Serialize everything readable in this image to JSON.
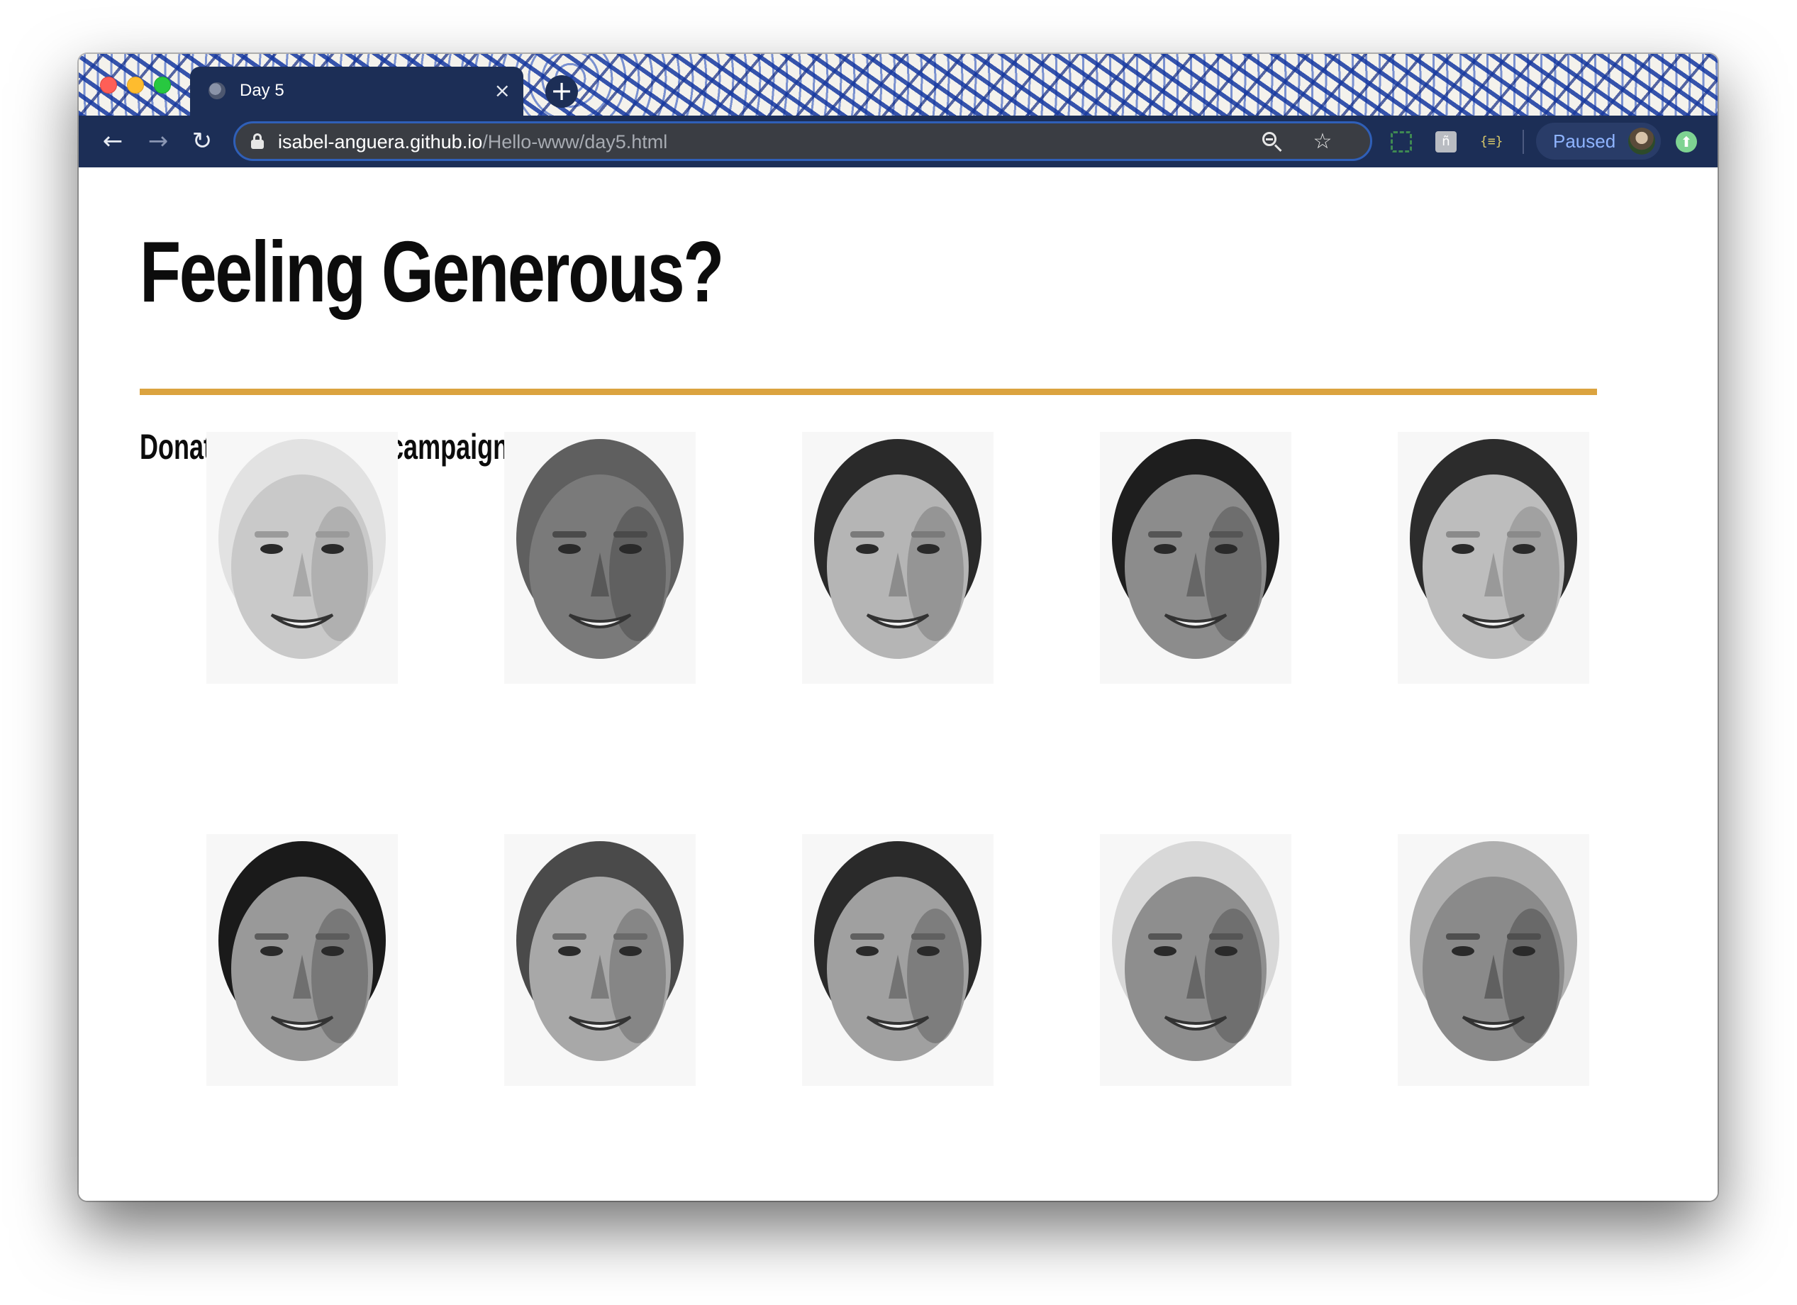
{
  "browser": {
    "tab": {
      "title": "Day 5",
      "close_glyph": "×"
    },
    "new_tab_glyph": "+",
    "nav": {
      "back_glyph": "←",
      "forward_glyph": "→",
      "reload_glyph": "↻"
    },
    "address": {
      "host": "isabel-anguera.github.io",
      "path": "/Hello-www/day5.html"
    },
    "bookmark_glyph": "☆",
    "extensions": {
      "square_glyph": "ñ",
      "brackets_glyph": "{≡}"
    },
    "profile": {
      "label": "Paused"
    },
    "update_glyph": "⬆"
  },
  "page": {
    "title": "Feeling Generous?",
    "subtitle": "Donate to a political campaign:",
    "accent_color": "#dba33f"
  },
  "candidates": [
    {
      "icon": "face-portrait-icon",
      "skin": "#c9c9c9",
      "hair": "#e2e2e2",
      "shadow": "#9a9a9a"
    },
    {
      "icon": "face-portrait-icon",
      "skin": "#7a7a7a",
      "hair": "#5f5f5f",
      "shadow": "#4a4a4a"
    },
    {
      "icon": "face-portrait-icon",
      "skin": "#b5b5b5",
      "hair": "#2a2a2a",
      "shadow": "#7a7a7a"
    },
    {
      "icon": "face-portrait-icon",
      "skin": "#8c8c8c",
      "hair": "#1e1e1e",
      "shadow": "#555555"
    },
    {
      "icon": "face-portrait-icon",
      "skin": "#bdbdbd",
      "hair": "#2c2c2c",
      "shadow": "#8a8a8a"
    },
    {
      "icon": "face-portrait-icon",
      "skin": "#999999",
      "hair": "#1a1a1a",
      "shadow": "#5c5c5c"
    },
    {
      "icon": "face-portrait-icon",
      "skin": "#a8a8a8",
      "hair": "#4a4a4a",
      "shadow": "#6a6a6a"
    },
    {
      "icon": "face-portrait-icon",
      "skin": "#a0a0a0",
      "hair": "#2a2a2a",
      "shadow": "#606060"
    },
    {
      "icon": "face-portrait-icon",
      "skin": "#8e8e8e",
      "hair": "#d8d8d8",
      "shadow": "#555555"
    },
    {
      "icon": "face-portrait-icon",
      "skin": "#8a8a8a",
      "hair": "#b0b0b0",
      "shadow": "#4f4f4f"
    }
  ]
}
